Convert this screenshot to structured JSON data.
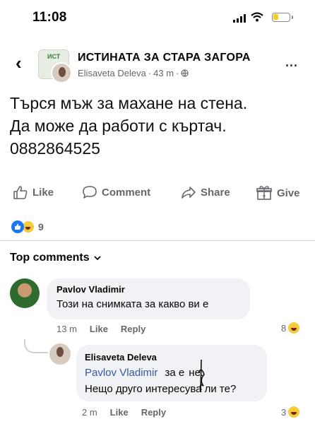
{
  "status_bar": {
    "time": "11:08",
    "battery_color": "#f2cf1d"
  },
  "header": {
    "back_icon": "chevron-left",
    "group_name": "ИСТИНАТА ЗА СТАРА ЗАГОРА",
    "author": "Elisaveta Deleva",
    "time_ago": "43 m",
    "separator": "·",
    "audience_icon": "globe-icon",
    "more_label": "..."
  },
  "post": {
    "lines": [
      "Търся мъж за махане на стена.",
      "Да може да работи с къртач.",
      "0882864525"
    ]
  },
  "actions": {
    "like": "Like",
    "comment": "Comment",
    "share": "Share",
    "give": "Give"
  },
  "reactions": {
    "count": "9"
  },
  "comments_header": {
    "label": "Top comments"
  },
  "comments": [
    {
      "author": "Pavlov Vladimir",
      "text": "Този на снимката за какво ви е",
      "time": "13 m",
      "like": "Like",
      "reply": "Reply",
      "reaction_count": "8"
    },
    {
      "author": "Elisaveta Deleva",
      "mention": "Pavlov Vladimir",
      "text_after_mention": "за е",
      "text_tail": "не.",
      "line2": "Нещо друго интересува ли те?",
      "time": "2 m",
      "like": "Like",
      "reply": "Reply",
      "reaction_count": "3"
    }
  ],
  "colors": {
    "accent": "#1877f2",
    "secondary_text": "#65676b",
    "bubble": "#f0f2f5",
    "mention": "#385898"
  }
}
